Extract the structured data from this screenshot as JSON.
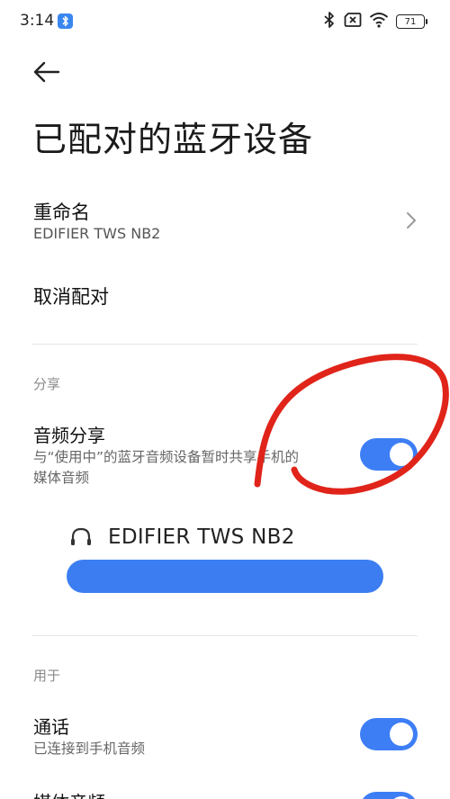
{
  "status_bar": {
    "time": "3:14",
    "battery": "71",
    "icons": [
      "bluetooth-badge-icon",
      "bluetooth-icon",
      "sim-off-icon",
      "wifi-icon",
      "battery-icon"
    ],
    "accent_color": "#3a86f0"
  },
  "header": {
    "title": "已配对的蓝牙设备",
    "back_icon": "back-arrow-icon"
  },
  "rename": {
    "label": "重命名",
    "value": "EDIFIER TWS NB2"
  },
  "unpair": {
    "label": "取消配对"
  },
  "share_section": {
    "label": "分享",
    "audio_share": {
      "title": "音频分享",
      "description_line1": "与“使用中”的蓝牙音频设备暂时共享手机的",
      "description_line2": "媒体音频",
      "enabled": true
    },
    "device": {
      "name": "EDIFIER TWS NB2",
      "icon": "headphones-icon"
    }
  },
  "use_section": {
    "label": "用于",
    "call": {
      "title": "通话",
      "description": "已连接到手机音频",
      "enabled": true
    },
    "media": {
      "title": "媒体音频",
      "enabled": true
    }
  },
  "colors": {
    "toggle_on": "#3d7ef5",
    "annotation": "#e0241a"
  }
}
